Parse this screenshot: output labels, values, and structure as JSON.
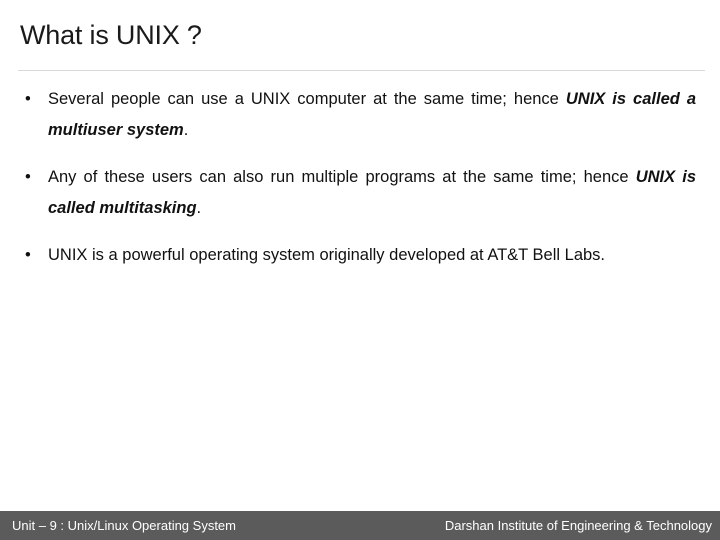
{
  "slide": {
    "title": "What is UNIX ?",
    "bullet_marker": "•",
    "bullets": [
      {
        "lead": "Several people can use a UNIX computer at the same time; hence ",
        "emphasis": "UNIX is called a multiuser system",
        "tail": "."
      },
      {
        "lead": "Any of these users can also run multiple programs at the same time; hence ",
        "emphasis": "UNIX is called multitasking",
        "tail": "."
      },
      {
        "lead": "UNIX is a powerful operating system originally developed at AT&T Bell Labs.",
        "emphasis": "",
        "tail": ""
      }
    ]
  },
  "footer": {
    "left": "Unit – 9 : Unix/Linux Operating System",
    "right": "Darshan Institute of Engineering & Technology",
    "background_color": "#5b5b5b",
    "text_color": "#ffffff"
  },
  "theme": {
    "page_background": "#ffffff",
    "text_color": "#111111",
    "divider_color": "#d9d9d9"
  }
}
